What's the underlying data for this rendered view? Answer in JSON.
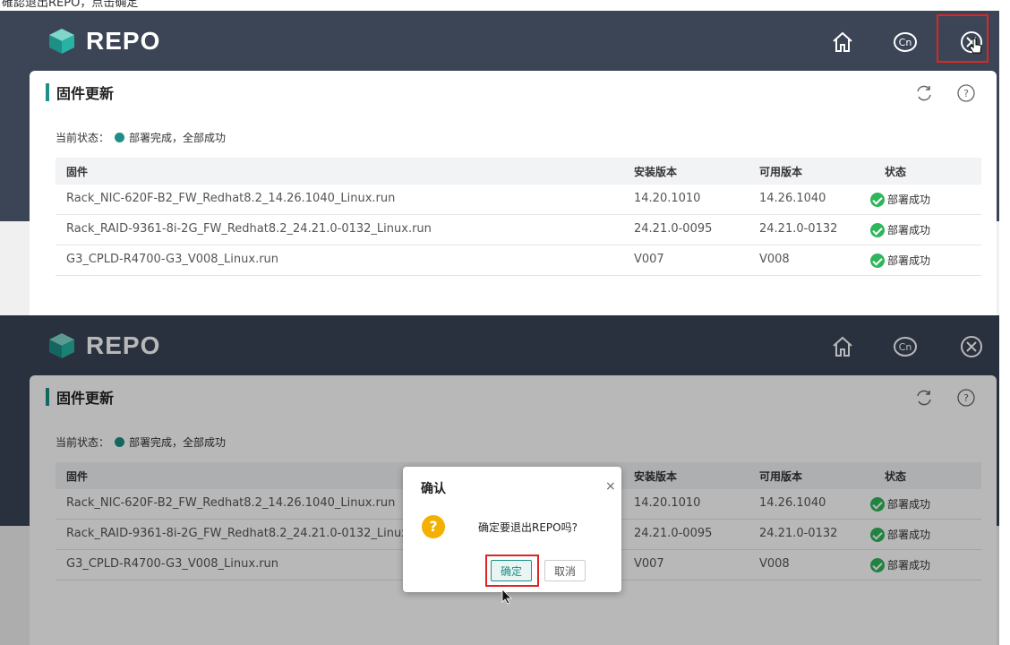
{
  "caption_fragment": "確認退出REPO，点击确定",
  "app": {
    "brand": "REPO",
    "icons": [
      "home-icon",
      "language-cn-icon",
      "close-circle-icon"
    ],
    "language_badge": "Cn"
  },
  "panel": {
    "title": "固件更新",
    "status_label": "当前状态：",
    "status_text": "部署完成，全部成功",
    "columns": [
      "固件",
      "安装版本",
      "可用版本",
      "状态"
    ],
    "rows": [
      {
        "firmware": "Rack_NIC-620F-B2_FW_Redhat8.2_14.26.1040_Linux.run",
        "installed": "14.20.1010",
        "available": "14.26.1040",
        "status": "部署成功"
      },
      {
        "firmware": "Rack_RAID-9361-8i-2G_FW_Redhat8.2_24.21.0-0132_Linux.run",
        "installed": "24.21.0-0095",
        "available": "24.21.0-0132",
        "status": "部署成功"
      },
      {
        "firmware": "G3_CPLD-R4700-G3_V008_Linux.run",
        "installed": "V007",
        "available": "V008",
        "status": "部署成功"
      }
    ]
  },
  "dialog": {
    "title": "确认",
    "close": "×",
    "icon": "?",
    "message": "确定要退出REPO吗?",
    "confirm": "确定",
    "cancel": "取消"
  },
  "colors": {
    "header": "#3b4556",
    "accent": "#1d8f86",
    "success": "#2fb55b",
    "warning": "#f4b000",
    "highlight": "#e02424"
  }
}
